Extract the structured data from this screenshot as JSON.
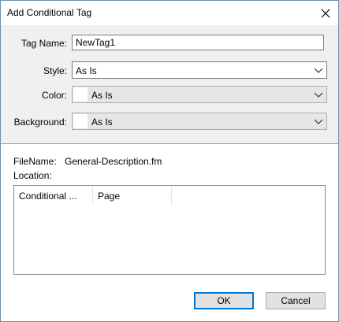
{
  "window": {
    "title": "Add Conditional Tag",
    "close_icon": "close-icon"
  },
  "form": {
    "tag_name_label": "Tag Name:",
    "tag_name_value": "NewTag1",
    "style_label": "Style:",
    "style_value": "As Is",
    "color_label": "Color:",
    "color_value": "As Is",
    "background_label": "Background:",
    "background_value": "As Is"
  },
  "info": {
    "filename_label": "FileName:",
    "filename_value": "General-Description.fm",
    "location_label": "Location:"
  },
  "table": {
    "columns": [
      "Conditional ...",
      "Page"
    ],
    "rows": []
  },
  "buttons": {
    "ok": "OK",
    "cancel": "Cancel"
  },
  "colors": {
    "accent": "#0078d7",
    "dialog_bg": "#f0f0f0",
    "border": "#6d8fb3"
  }
}
